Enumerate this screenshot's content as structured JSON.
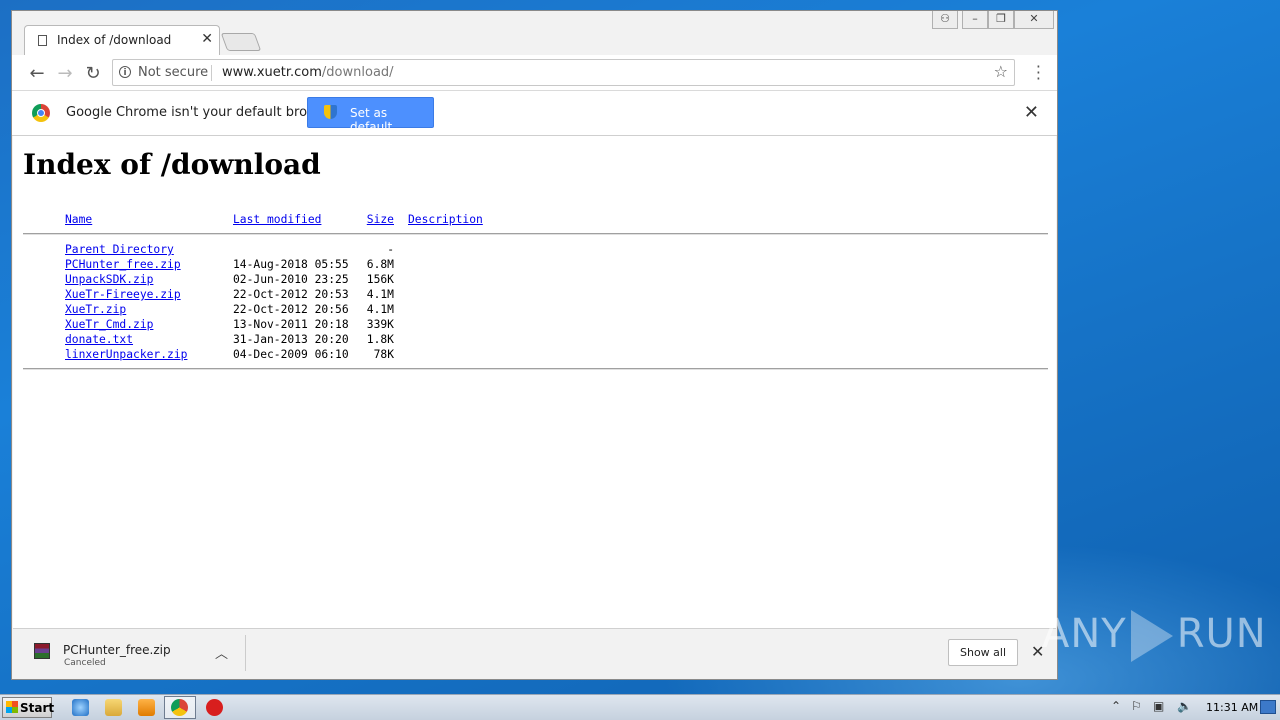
{
  "browser": {
    "tab_title": "Index of /download",
    "address": {
      "security_label": "Not secure",
      "host": "www.xuetr.com",
      "path": "/download/"
    }
  },
  "infobar": {
    "message": "Google Chrome isn't your default browser",
    "button_label": "Set as default"
  },
  "page": {
    "title": "Index of /download",
    "columns": {
      "name": "Name",
      "modified": "Last modified",
      "size": "Size",
      "description": "Description"
    },
    "parent": {
      "name": "Parent Directory",
      "size": "-"
    },
    "files": [
      {
        "name": "PCHunter_free.zip",
        "modified": "14-Aug-2018 05:55",
        "size": "6.8M"
      },
      {
        "name": "UnpackSDK.zip",
        "modified": "02-Jun-2010 23:25",
        "size": "156K"
      },
      {
        "name": "XueTr-Fireeye.zip",
        "modified": "22-Oct-2012 20:53",
        "size": "4.1M"
      },
      {
        "name": "XueTr.zip",
        "modified": "22-Oct-2012 20:56",
        "size": "4.1M"
      },
      {
        "name": "XueTr_Cmd.zip",
        "modified": "13-Nov-2011 20:18",
        "size": "339K"
      },
      {
        "name": "donate.txt",
        "modified": "31-Jan-2013 20:20",
        "size": "1.8K"
      },
      {
        "name": "linxerUnpacker.zip",
        "modified": "04-Dec-2009 06:10",
        "size": "78K"
      }
    ]
  },
  "download_bar": {
    "filename": "PCHunter_free.zip",
    "status": "Canceled",
    "show_all_label": "Show all"
  },
  "watermark": {
    "left": "ANY",
    "right": "RUN"
  },
  "taskbar": {
    "start_label": "Start",
    "clock": "11:31 AM"
  }
}
